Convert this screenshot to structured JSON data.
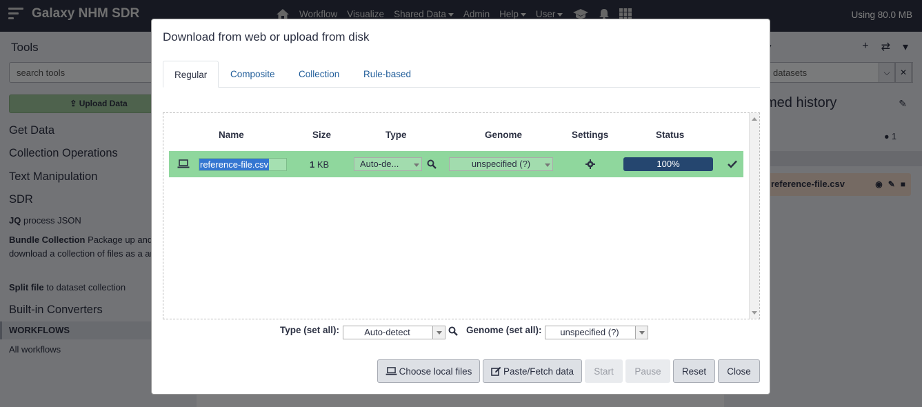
{
  "masthead": {
    "brand": "Galaxy NHM SDR",
    "nav": [
      {
        "label": "Workflow",
        "caret": false
      },
      {
        "label": "Visualize",
        "caret": false
      },
      {
        "label": "Shared Data",
        "caret": true
      },
      {
        "label": "Admin",
        "caret": false
      },
      {
        "label": "Help",
        "caret": true
      },
      {
        "label": "User",
        "caret": true
      }
    ],
    "usage": "Using 80.0 MB"
  },
  "tool_panel": {
    "title": "Tools",
    "search_placeholder": "search tools",
    "upload_label": "Upload Data",
    "sections": [
      "Get Data",
      "Collection Operations",
      "Text Manipulation",
      "SDR"
    ],
    "tools": [
      {
        "name": "JQ",
        "desc": "process JSON"
      },
      {
        "name": "Bundle Collection",
        "desc": "Package up and download a collection of files as a archive."
      },
      {
        "name": "Split file",
        "desc": "to dataset collection"
      }
    ],
    "converters": "Built-in Converters",
    "workflows_header": "WORKFLOWS",
    "all_workflows": "All workflows"
  },
  "history_panel": {
    "title_fragment": "y",
    "search_fragment": "datasets",
    "history_name_fragment": "med history",
    "count": "1",
    "dataset_fragment": "reference-file.csv"
  },
  "modal": {
    "title": "Download from web or upload from disk",
    "tabs": [
      {
        "label": "Regular",
        "active": true
      },
      {
        "label": "Composite",
        "active": false
      },
      {
        "label": "Collection",
        "active": false
      },
      {
        "label": "Rule-based",
        "active": false
      }
    ],
    "columns": [
      "Name",
      "Size",
      "Type",
      "Genome",
      "Settings",
      "Status"
    ],
    "row": {
      "name": "reference-file.csv",
      "size_value": "1",
      "size_unit": "KB",
      "type": "Auto-de...",
      "genome": "unspecified (?)",
      "progress_percent": 100,
      "progress_label": "100%"
    },
    "setall": {
      "type_label": "Type (set all):",
      "type_value": "Auto-detect",
      "genome_label": "Genome (set all):",
      "genome_value": "unspecified (?)"
    },
    "buttons": {
      "choose": "Choose local files",
      "paste": "Paste/Fetch data",
      "start": "Start",
      "pause": "Pause",
      "reset": "Reset",
      "close": "Close"
    }
  }
}
